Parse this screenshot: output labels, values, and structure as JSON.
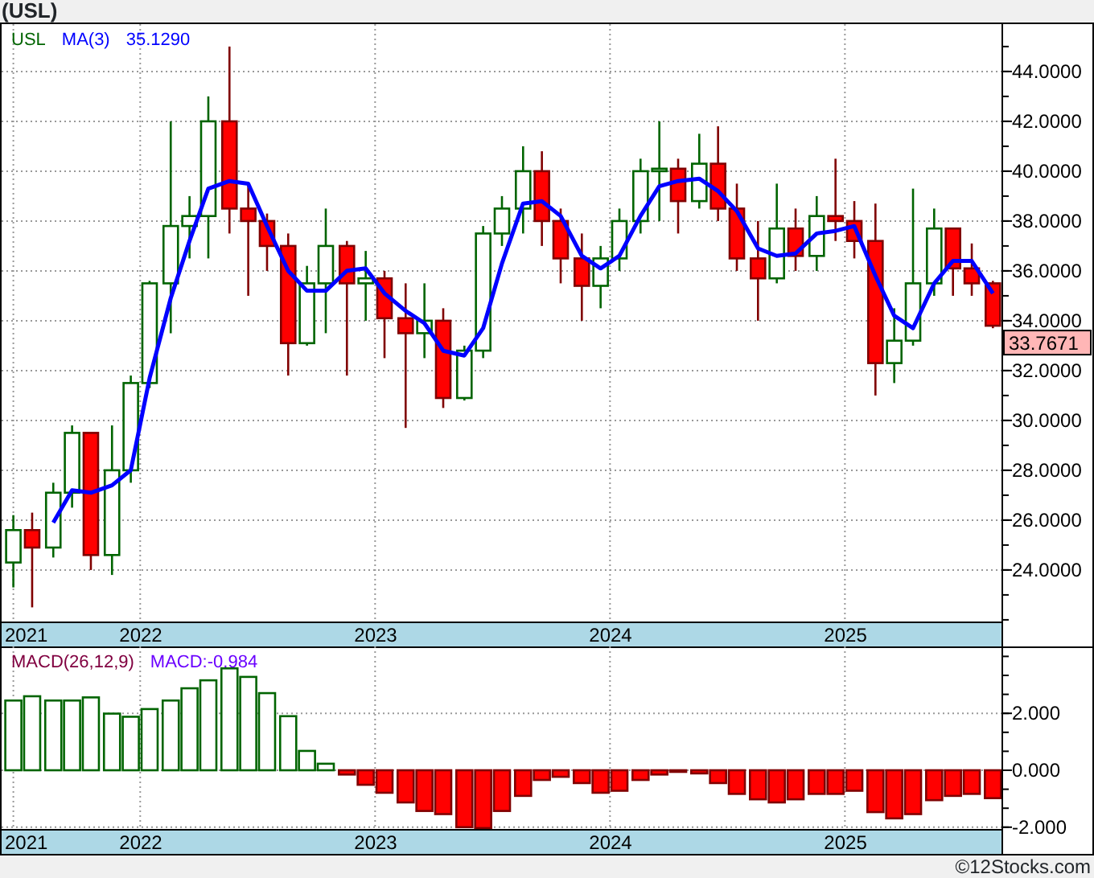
{
  "title": "(USL)",
  "price_panel": {
    "ma_value": "35.1290",
    "last_label": "33.7671",
    "chart_data": {
      "type": "candlestick",
      "title": "USL",
      "grid": true,
      "ylim": [
        21.9,
        45.9
      ],
      "yticks": [
        {
          "value": 24,
          "label": "24.0000"
        },
        {
          "value": 26,
          "label": "26.0000"
        },
        {
          "value": 28,
          "label": "28.0000"
        },
        {
          "value": 30,
          "label": "30.0000"
        },
        {
          "value": 32,
          "label": "32.0000"
        },
        {
          "value": 34,
          "label": "34.0000"
        },
        {
          "value": 36,
          "label": "36.0000"
        },
        {
          "value": 38,
          "label": "38.0000"
        },
        {
          "value": 40,
          "label": "40.0000"
        },
        {
          "value": 42,
          "label": "42.0000"
        },
        {
          "value": 44,
          "label": "44.0000"
        }
      ],
      "x": [
        2021.46,
        2021.54,
        2021.63,
        2021.71,
        2021.79,
        2021.88,
        2021.96,
        2022.04,
        2022.13,
        2022.21,
        2022.29,
        2022.38,
        2022.46,
        2022.54,
        2022.63,
        2022.71,
        2022.79,
        2022.88,
        2022.96,
        2023.04,
        2023.13,
        2023.21,
        2023.29,
        2023.38,
        2023.46,
        2023.54,
        2023.63,
        2023.71,
        2023.79,
        2023.88,
        2023.96,
        2024.04,
        2024.13,
        2024.21,
        2024.29,
        2024.38,
        2024.46,
        2024.54,
        2024.63,
        2024.71,
        2024.79,
        2024.88,
        2024.96,
        2025.04,
        2025.13,
        2025.21,
        2025.29,
        2025.38,
        2025.46,
        2025.54,
        2025.63
      ],
      "xlim": [
        2021.41,
        2025.67
      ],
      "xticks": [
        {
          "value": 2021.46,
          "label": "2021"
        },
        {
          "value": 2022,
          "label": "2022"
        },
        {
          "value": 2023,
          "label": "2023"
        },
        {
          "value": 2024,
          "label": "2024"
        },
        {
          "value": 2025,
          "label": "2025"
        }
      ],
      "ohlc": [
        [
          24.3,
          26.2,
          23.3,
          25.6
        ],
        [
          25.6,
          26.3,
          22.5,
          24.9
        ],
        [
          24.9,
          27.5,
          24.5,
          27.1
        ],
        [
          27.1,
          29.8,
          26.5,
          29.5
        ],
        [
          29.5,
          29.5,
          24.0,
          24.6
        ],
        [
          24.6,
          29.8,
          23.8,
          28.0
        ],
        [
          28.0,
          31.8,
          27.5,
          31.5
        ],
        [
          31.5,
          35.6,
          31.3,
          35.5
        ],
        [
          35.5,
          42.0,
          33.5,
          37.8
        ],
        [
          37.8,
          39.0,
          36.5,
          38.2
        ],
        [
          38.2,
          43.0,
          36.5,
          42.0
        ],
        [
          42.0,
          45.0,
          37.5,
          38.5
        ],
        [
          38.5,
          39.5,
          35.0,
          38.0
        ],
        [
          38.0,
          38.3,
          36.0,
          37.0
        ],
        [
          37.0,
          37.5,
          31.8,
          33.1
        ],
        [
          33.1,
          36.2,
          33.0,
          35.5
        ],
        [
          35.5,
          38.5,
          33.5,
          37.0
        ],
        [
          37.0,
          37.2,
          31.8,
          35.5
        ],
        [
          35.5,
          36.8,
          34.0,
          35.7
        ],
        [
          35.7,
          36.0,
          32.5,
          34.1
        ],
        [
          34.1,
          35.5,
          29.7,
          33.5
        ],
        [
          33.5,
          35.5,
          32.5,
          34.0
        ],
        [
          34.0,
          34.5,
          30.5,
          30.9
        ],
        [
          30.9,
          33.0,
          30.8,
          32.8
        ],
        [
          32.8,
          37.8,
          32.5,
          37.5
        ],
        [
          37.5,
          39.0,
          37.0,
          38.5
        ],
        [
          38.5,
          41.0,
          37.5,
          40.0
        ],
        [
          40.0,
          40.8,
          37.0,
          38.0
        ],
        [
          38.0,
          38.5,
          35.5,
          36.5
        ],
        [
          36.5,
          37.5,
          34.0,
          35.4
        ],
        [
          35.4,
          37.0,
          34.5,
          36.5
        ],
        [
          36.5,
          38.5,
          36.0,
          38.0
        ],
        [
          38.0,
          40.5,
          37.5,
          40.0
        ],
        [
          40.0,
          42.0,
          38.0,
          40.1
        ],
        [
          40.1,
          40.5,
          37.5,
          38.8
        ],
        [
          38.8,
          41.5,
          38.5,
          40.3
        ],
        [
          40.3,
          41.8,
          38.0,
          38.5
        ],
        [
          38.5,
          39.5,
          36.0,
          36.5
        ],
        [
          36.5,
          38.0,
          34.0,
          35.7
        ],
        [
          35.7,
          39.5,
          35.5,
          37.7
        ],
        [
          37.7,
          38.5,
          36.0,
          36.6
        ],
        [
          36.6,
          39.0,
          36.0,
          38.2
        ],
        [
          38.2,
          40.5,
          37.2,
          38.0
        ],
        [
          38.0,
          38.8,
          36.5,
          37.2
        ],
        [
          37.2,
          38.7,
          31.0,
          32.3
        ],
        [
          32.3,
          34.5,
          31.5,
          33.2
        ],
        [
          33.2,
          39.3,
          33.0,
          35.5
        ],
        [
          35.5,
          38.5,
          35.0,
          37.7
        ],
        [
          37.7,
          37.7,
          35.0,
          36.1
        ],
        [
          36.1,
          37.1,
          35.0,
          35.5
        ],
        [
          35.5,
          35.6,
          33.7,
          33.8
        ]
      ],
      "series": [
        {
          "name": "MA(3)",
          "type": "line",
          "color": "#0000ff",
          "x": [
            2021.63,
            2021.71,
            2021.79,
            2021.88,
            2021.96,
            2022.04,
            2022.13,
            2022.21,
            2022.29,
            2022.38,
            2022.46,
            2022.54,
            2022.63,
            2022.71,
            2022.79,
            2022.88,
            2022.96,
            2023.04,
            2023.13,
            2023.21,
            2023.29,
            2023.38,
            2023.46,
            2023.54,
            2023.63,
            2023.71,
            2023.79,
            2023.88,
            2023.96,
            2024.04,
            2024.13,
            2024.21,
            2024.29,
            2024.38,
            2024.46,
            2024.54,
            2024.63,
            2024.71,
            2024.79,
            2024.88,
            2024.96,
            2025.04,
            2025.13,
            2025.21,
            2025.29,
            2025.38,
            2025.46,
            2025.54,
            2025.63
          ],
          "values": [
            25.9,
            27.2,
            27.1,
            27.4,
            28.0,
            31.7,
            34.9,
            37.2,
            39.3,
            39.6,
            39.5,
            37.8,
            36.0,
            35.2,
            35.2,
            36.0,
            36.1,
            35.1,
            34.4,
            33.9,
            32.8,
            32.6,
            33.7,
            36.3,
            38.7,
            38.8,
            38.2,
            36.6,
            36.1,
            36.6,
            38.2,
            39.4,
            39.6,
            39.7,
            39.2,
            38.4,
            36.9,
            36.6,
            36.7,
            37.5,
            37.6,
            37.8,
            35.8,
            34.2,
            33.7,
            35.5,
            36.4,
            36.4,
            35.1
          ]
        }
      ]
    }
  },
  "macd_panel": {
    "macd_value": "MACD:-0.984",
    "chart_data": {
      "type": "bar",
      "grid": true,
      "ylim": [
        -2.09,
        4.35
      ],
      "x": [
        2021.46,
        2021.54,
        2021.63,
        2021.71,
        2021.79,
        2021.88,
        2021.96,
        2022.04,
        2022.13,
        2022.21,
        2022.29,
        2022.38,
        2022.46,
        2022.54,
        2022.63,
        2022.71,
        2022.79,
        2022.88,
        2022.96,
        2023.04,
        2023.13,
        2023.21,
        2023.29,
        2023.38,
        2023.46,
        2023.54,
        2023.63,
        2023.71,
        2023.79,
        2023.88,
        2023.96,
        2024.04,
        2024.13,
        2024.21,
        2024.29,
        2024.38,
        2024.46,
        2024.54,
        2024.63,
        2024.71,
        2024.79,
        2024.88,
        2024.96,
        2025.04,
        2025.13,
        2025.21,
        2025.29,
        2025.38,
        2025.46,
        2025.54,
        2025.63
      ],
      "xlim": [
        2021.41,
        2025.67
      ],
      "xticks": [
        {
          "value": 2021.46,
          "label": "2021"
        },
        {
          "value": 2022,
          "label": "2022"
        },
        {
          "value": 2023,
          "label": "2023"
        },
        {
          "value": 2024,
          "label": "2024"
        },
        {
          "value": 2025,
          "label": "2025"
        }
      ],
      "yticks": [
        {
          "value": -2,
          "label": "-2.000"
        },
        {
          "value": 0,
          "label": "0.000"
        },
        {
          "value": 2,
          "label": "2.000"
        }
      ],
      "series": [
        {
          "name": "MACD(26,12,9)",
          "values": [
            2.45,
            2.6,
            2.45,
            2.45,
            2.56,
            1.99,
            1.88,
            2.15,
            2.45,
            2.88,
            3.16,
            3.58,
            3.28,
            2.71,
            1.9,
            0.68,
            0.23,
            -0.15,
            -0.51,
            -0.79,
            -1.13,
            -1.43,
            -1.54,
            -2.0,
            -2.03,
            -1.43,
            -0.9,
            -0.34,
            -0.23,
            -0.45,
            -0.79,
            -0.72,
            -0.34,
            -0.15,
            -0.04,
            -0.11,
            -0.45,
            -0.83,
            -1.02,
            -1.13,
            -1.02,
            -0.83,
            -0.83,
            -0.72,
            -1.47,
            -1.69,
            -1.54,
            -1.05,
            -0.9,
            -0.83,
            -0.98
          ]
        }
      ]
    }
  },
  "copyright": "©12Stocks.com"
}
